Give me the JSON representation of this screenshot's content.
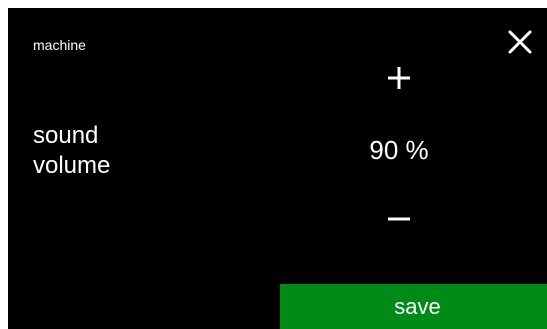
{
  "header": {
    "breadcrumb": "machine",
    "close_icon": "close-icon"
  },
  "setting": {
    "label_line1": "sound",
    "label_line2": "volume",
    "value": "90 %",
    "level_percent": 90,
    "increase_icon": "plus-icon",
    "decrease_icon": "minus-icon"
  },
  "footer": {
    "save_label": "save"
  },
  "colors": {
    "background": "#000000",
    "text": "#ffffff",
    "save_button": "#008a17"
  }
}
